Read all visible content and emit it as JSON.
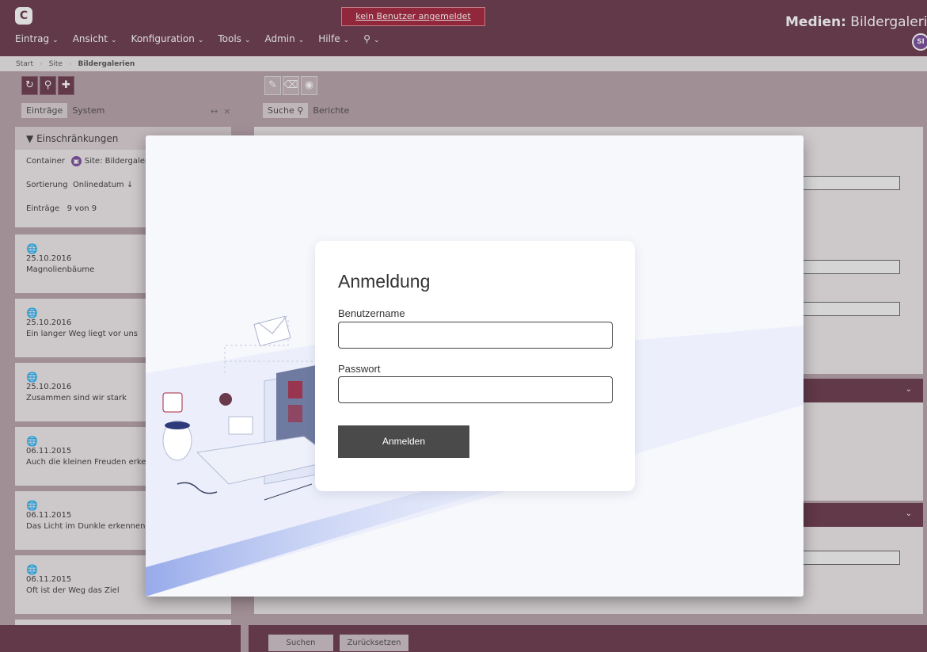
{
  "app": {
    "logo": "C",
    "alert": "kein Benutzer angemeldet",
    "title_bold": "Medien:",
    "title_rest": "Bildergalerien",
    "user_initials": "SI"
  },
  "menu": [
    "Eintrag",
    "Ansicht",
    "Konfiguration",
    "Tools",
    "Admin",
    "Hilfe",
    "Q"
  ],
  "breadcrumb": [
    "Start",
    "Site",
    "Bildergalerien"
  ],
  "left": {
    "tabs": [
      "Einträge",
      "System"
    ],
    "filter": {
      "title": "Einschränkungen",
      "container_label": "Container",
      "container_value": "Site: Bildergalerien",
      "sort_label": "Sortierung",
      "sort_value": "Onlinedatum ↓",
      "count_label": "Einträge",
      "count_value": "9 von 9"
    },
    "entries": [
      {
        "date": "25.10.2016",
        "title": "Magnolienbäume"
      },
      {
        "date": "25.10.2016",
        "title": "Ein langer Weg liegt vor uns"
      },
      {
        "date": "25.10.2016",
        "title": "Zusammen sind wir stark"
      },
      {
        "date": "06.11.2015",
        "title": "Auch die kleinen Freuden erkennen"
      },
      {
        "date": "06.11.2015",
        "title": "Das Licht im Dunkle erkennen"
      },
      {
        "date": "06.11.2015",
        "title": "Oft ist der Weg das Ziel"
      }
    ]
  },
  "right": {
    "tabs": [
      "Suche",
      "Berichte"
    ]
  },
  "bottom": {
    "search": "Suchen",
    "reset": "Zurücksetzen"
  },
  "login": {
    "title": "Anmeldung",
    "username_label": "Benutzername",
    "username_value": "",
    "password_label": "Passwort",
    "password_value": "",
    "submit": "Anmelden"
  }
}
